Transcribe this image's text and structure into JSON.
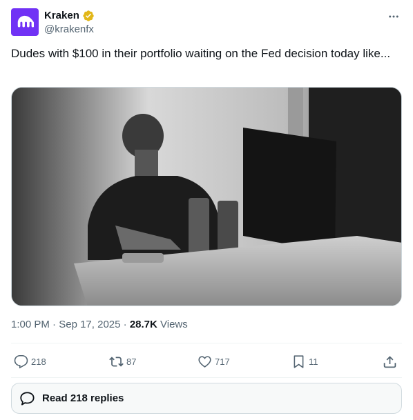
{
  "author": {
    "name": "Kraken",
    "handle": "@krakenfx",
    "avatar_color": "#7132f5",
    "verified_badge_color": "#e2b719"
  },
  "tweet": {
    "text": "Dudes with $100 in their portfolio waiting on the Fed decision today like...",
    "media_description_icon": "photo"
  },
  "meta": {
    "time": "1:00 PM",
    "sep1": " · ",
    "date": "Sep 17, 2025",
    "sep2": " · ",
    "views_count": "28.7K",
    "views_label": " Views"
  },
  "actions": {
    "replies": "218",
    "reposts": "87",
    "likes": "717",
    "bookmarks": "11"
  },
  "read_replies_label": "Read 218 replies",
  "colors": {
    "text_secondary": "#536471",
    "border": "#cfd9de"
  }
}
